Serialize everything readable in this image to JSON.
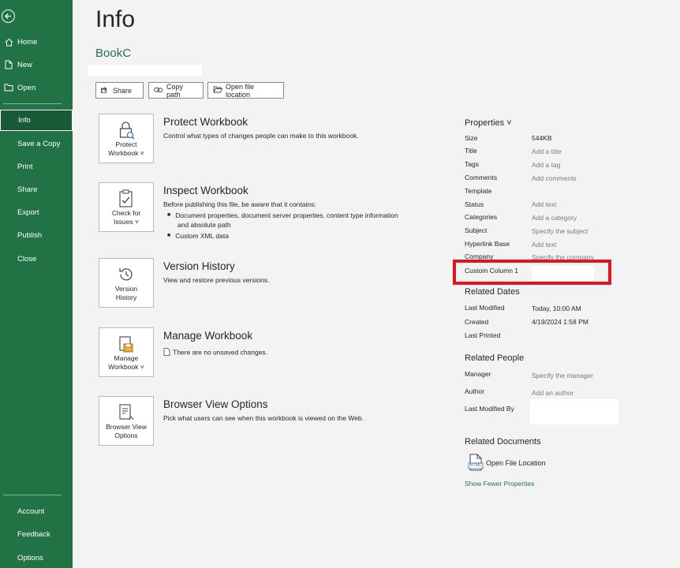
{
  "sidebar": {
    "items": [
      {
        "label": "Home",
        "icon": "home-icon"
      },
      {
        "label": "New",
        "icon": "new-file-icon"
      },
      {
        "label": "Open",
        "icon": "folder-icon"
      },
      {
        "label": "Info"
      },
      {
        "label": "Save a Copy"
      },
      {
        "label": "Print"
      },
      {
        "label": "Share"
      },
      {
        "label": "Export"
      },
      {
        "label": "Publish"
      },
      {
        "label": "Close"
      }
    ],
    "bottom": [
      {
        "label": "Account"
      },
      {
        "label": "Feedback"
      },
      {
        "label": "Options"
      }
    ]
  },
  "main": {
    "title": "Info",
    "book_name": "BookC",
    "buttons": {
      "share": "Share",
      "copy_path": "Copy path",
      "open_location": "Open file location"
    },
    "sections": {
      "protect": {
        "card": [
          "Protect",
          "Workbook ˅"
        ],
        "title": "Protect Workbook",
        "desc": "Control what types of changes people can make to this workbook."
      },
      "inspect": {
        "card": [
          "Check for",
          "Issues ˅"
        ],
        "title": "Inspect Workbook",
        "desc": "Before publishing this file, be aware that it contains:",
        "bullets": [
          "Document properties, document server properties, content type information",
          "and absolute path",
          "Custom XML data"
        ]
      },
      "version": {
        "card": [
          "Version",
          "History"
        ],
        "title": "Version History",
        "desc": "View and restore previous versions."
      },
      "manage": {
        "card": [
          "Manage",
          "Workbook ˅"
        ],
        "title": "Manage Workbook",
        "desc": "There are no unsaved changes."
      },
      "browser": {
        "card": [
          "Browser View",
          "Options"
        ],
        "title": "Browser View Options",
        "desc": "Pick what users can see when this workbook is viewed on the Web."
      }
    }
  },
  "properties": {
    "header": "Properties ˅",
    "rows": [
      {
        "label": "Size",
        "value": "544KB"
      },
      {
        "label": "Title",
        "value": "Add a title"
      },
      {
        "label": "Tags",
        "value": "Add a tag"
      },
      {
        "label": "Comments",
        "value": "Add comments"
      },
      {
        "label": "Template",
        "value": ""
      },
      {
        "label": "Status",
        "value": "Add text"
      },
      {
        "label": "Categories",
        "value": "Add a category"
      },
      {
        "label": "Subject",
        "value": "Specify the subject"
      },
      {
        "label": "Hyperlink Base",
        "value": "Add text"
      },
      {
        "label": "Company",
        "value": "Specify the company"
      },
      {
        "label": "Custom Column 1",
        "value": ""
      }
    ],
    "related_dates": {
      "header": "Related Dates",
      "rows": [
        {
          "label": "Last Modified",
          "value": "Today, 10:00 AM"
        },
        {
          "label": "Created",
          "value": "4/19/2024 1:58 PM"
        },
        {
          "label": "Last Printed",
          "value": ""
        }
      ]
    },
    "related_people": {
      "header": "Related People",
      "rows": [
        {
          "label": "Manager",
          "value": "Specify the manager"
        },
        {
          "label": "Author",
          "value": "Add an author"
        },
        {
          "label": "Last Modified By",
          "value": ""
        }
      ]
    },
    "related_documents": {
      "header": "Related Documents",
      "open_file_location": "Open File Location",
      "html_badge": "HTML"
    },
    "show_fewer": "Show Fewer Properties"
  },
  "colors": {
    "sidebar": "#217346",
    "accent": "#217346",
    "highlight_box": "#e3141d"
  }
}
